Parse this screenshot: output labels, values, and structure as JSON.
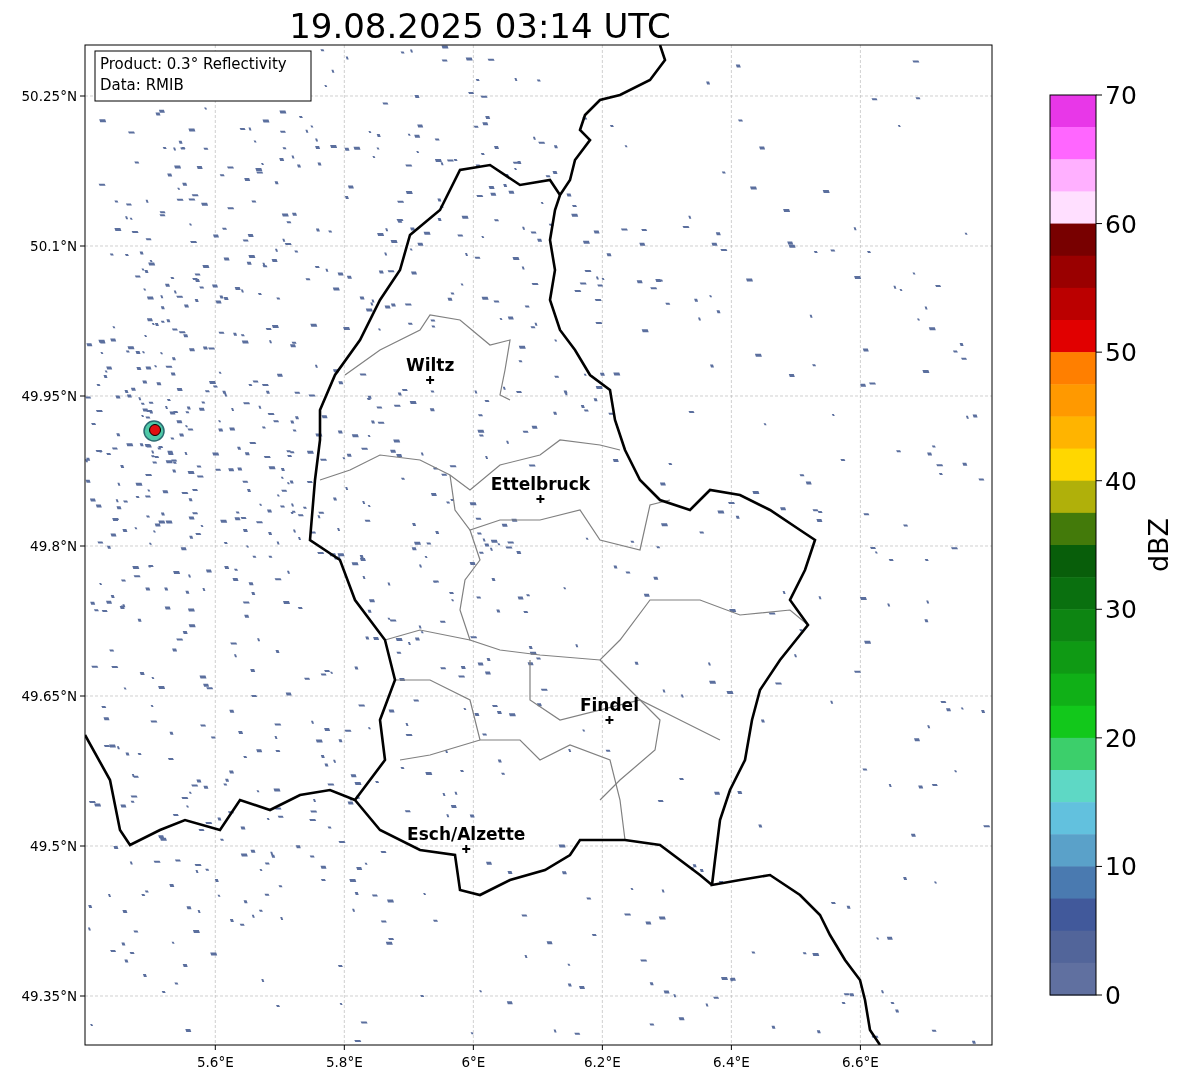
{
  "title": "19.08.2025 03:14 UTC",
  "info_box": [
    "Product: 0.3° Reflectivity",
    "Data: RMIB"
  ],
  "map": {
    "lat_labels": [
      "50.25°N",
      "50.1°N",
      "49.95°N",
      "49.8°N",
      "49.65°N",
      "49.5°N",
      "49.35°N"
    ],
    "lon_labels": [
      "5.6°E",
      "5.8°E",
      "6°E",
      "6.2°E",
      "6.4°E",
      "6.6°E"
    ],
    "cities": [
      {
        "name": "Wiltz"
      },
      {
        "name": "Ettelbruck"
      },
      {
        "name": "Findel"
      },
      {
        "name": "Esch/Alzette"
      }
    ]
  },
  "colorbar": {
    "label": "dBZ",
    "ticks": [
      "70",
      "60",
      "50",
      "40",
      "30",
      "20",
      "10",
      "0"
    ],
    "bins": [
      {
        "color": "#e837e8"
      },
      {
        "color": "#ff66ff"
      },
      {
        "color": "#ffb0ff"
      },
      {
        "color": "#ffdfff"
      },
      {
        "color": "#780000"
      },
      {
        "color": "#9a0000"
      },
      {
        "color": "#bb0000"
      },
      {
        "color": "#e10000"
      },
      {
        "color": "#ff7f00"
      },
      {
        "color": "#ff9900"
      },
      {
        "color": "#ffb400"
      },
      {
        "color": "#ffd700"
      },
      {
        "color": "#b0b00a"
      },
      {
        "color": "#437a0a"
      },
      {
        "color": "#085e0a"
      },
      {
        "color": "#0a700f"
      },
      {
        "color": "#0d8512"
      },
      {
        "color": "#0f9a14"
      },
      {
        "color": "#10b017"
      },
      {
        "color": "#12c81b"
      },
      {
        "color": "#3ccf6b"
      },
      {
        "color": "#5ed8c5"
      },
      {
        "color": "#62c1de"
      },
      {
        "color": "#5aa1c9"
      },
      {
        "color": "#4a7ab0"
      },
      {
        "color": "#41599b"
      },
      {
        "color": "#52659a"
      },
      {
        "color": "#6070a0"
      }
    ]
  }
}
